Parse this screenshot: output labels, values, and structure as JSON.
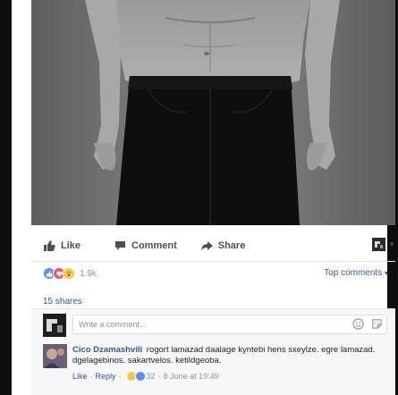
{
  "actions": {
    "like_label": "Like",
    "comment_label": "Comment",
    "share_label": "Share"
  },
  "reactions": {
    "count": "1.9k",
    "top_comments_label": "Top comments",
    "top_comments_caret": "▾"
  },
  "shares": "15 shares",
  "comment_box": {
    "placeholder": "Write a comment..."
  },
  "comment": {
    "author": "Cico Dzamashvili",
    "text": "rogort lamazad daalage kyntebi hens sxeylze. egre lamazad. dgelagebinos. sakartvelos. ketildgeoba.",
    "like_label": "Like",
    "reply_label": "Reply",
    "separator": "·",
    "reaction_count": "32",
    "timestamp": "8 June at 19:49"
  },
  "colors": {
    "link": "#365899",
    "muted": "#90949c",
    "like_blue": "#5890ff",
    "love_red": "#f25268",
    "wow_yellow": "#f7c948"
  }
}
